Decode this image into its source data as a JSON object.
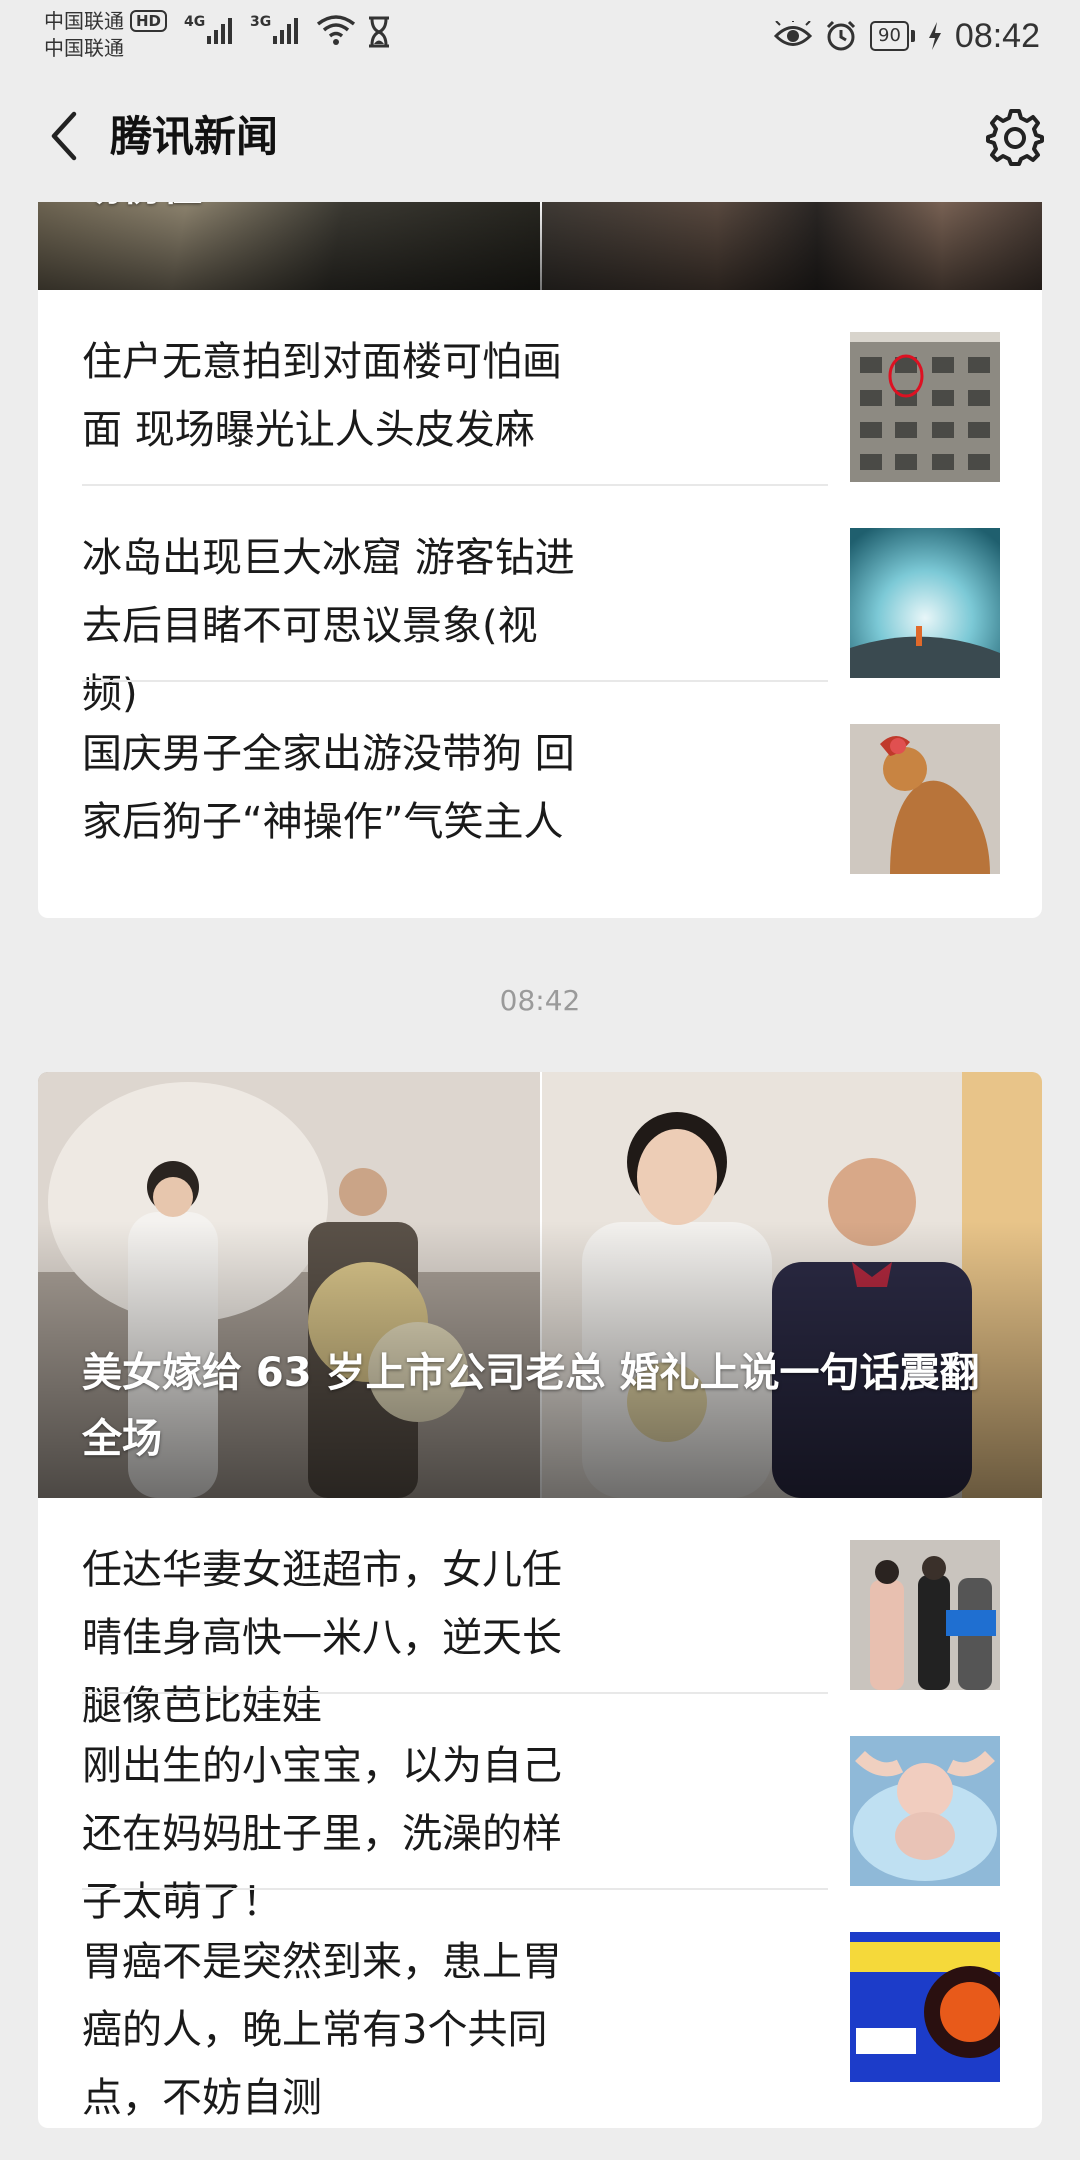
{
  "status_bar": {
    "carrier_1": "中国联通",
    "carrier_2": "中国联通",
    "hd_badge": "HD",
    "signal_1_label": "4G",
    "signal_2_label": "3G",
    "battery": "90",
    "time": "08:42",
    "icons": [
      "eye-icon",
      "alarm-icon",
      "charging-icon",
      "wifi-icon",
      "hourglass-icon"
    ]
  },
  "header": {
    "title": "腾讯新闻",
    "back_icon": "chevron-left-icon",
    "settings_icon": "gear-icon"
  },
  "feed": {
    "group_1": {
      "cover_title": "场愣住",
      "items": [
        {
          "title": "住户无意拍到对面楼可怕画面 现场曝光让人头皮发麻",
          "thumb": "building-photo"
        },
        {
          "title": "冰岛出现巨大冰窟 游客钻进去后目睹不可思议景象(视频)",
          "thumb": "ice-cave-photo"
        },
        {
          "title": "国庆男子全家出游没带狗 回家后狗子“神操作”气笑主人",
          "thumb": "dog-photo"
        }
      ]
    },
    "timestamp": "08:42",
    "group_2": {
      "cover_title": "美女嫁给 63 岁上市公司老总 婚礼上说一句话震翻全场",
      "items": [
        {
          "title": "任达华妻女逛超市，女儿任晴佳身高快一米八，逆天长腿像芭比娃娃",
          "thumb": "street-photo"
        },
        {
          "title": "刚出生的小宝宝，以为自己还在妈妈肚子里，洗澡的样子太萌了！",
          "thumb": "baby-bath-photo"
        },
        {
          "title": "胃癌不是突然到来，患上胃癌的人，晚上常有3个共同点，不妨自测",
          "thumb": "health-poster-photo"
        }
      ]
    }
  },
  "colors": {
    "page_bg": "#ededed",
    "card_bg": "#ffffff",
    "text": "#1a1a1a",
    "muted": "#9a9a9a"
  }
}
